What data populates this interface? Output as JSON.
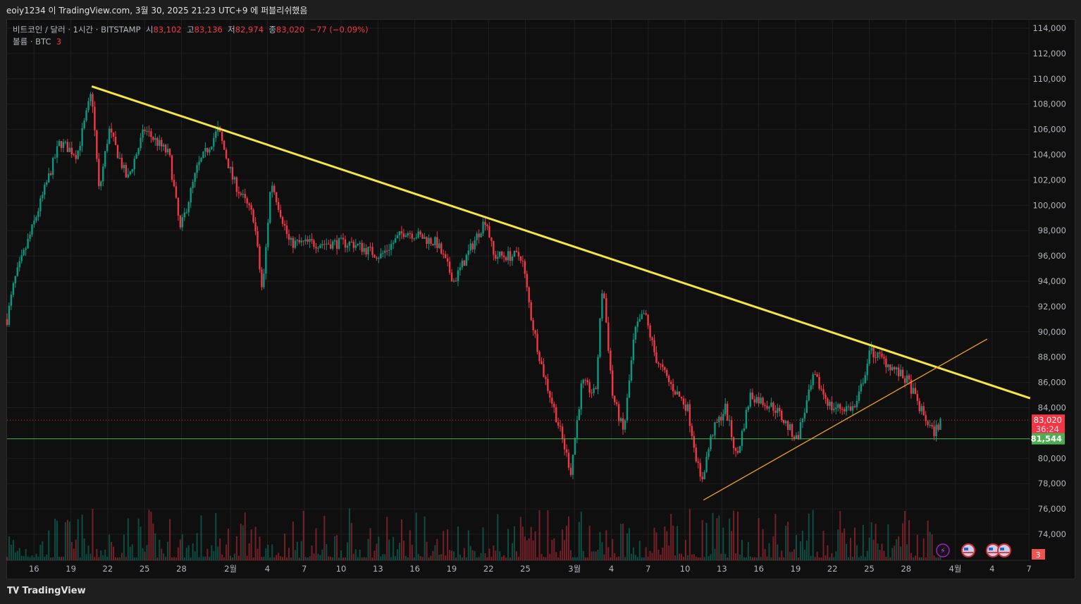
{
  "header": {
    "published": "eoiy1234 이 TradingView.com, 3월 30, 2025 21:23 UTC+9 에 퍼블리쉬했음"
  },
  "legend": {
    "symbol": "비트코인 / 달러 · 1시간 · BITSTAMP",
    "open_label": "시",
    "open": "83,102",
    "high_label": "고",
    "high": "83,136",
    "low_label": "저",
    "low": "82,974",
    "close_label": "종",
    "close": "83,020",
    "change": "−77 (−0.09%)",
    "volume_label": "볼륨 · BTC",
    "volume": "3"
  },
  "price_axis": [
    "114,000",
    "112,000",
    "110,000",
    "108,000",
    "106,000",
    "104,000",
    "102,000",
    "100,000",
    "98,000",
    "96,000",
    "94,000",
    "92,000",
    "90,000",
    "88,000",
    "86,000",
    "84,000",
    "80,000",
    "78,000",
    "76,000",
    "74,000"
  ],
  "time_axis": [
    {
      "label": "16",
      "day": 3
    },
    {
      "label": "19",
      "day": 6
    },
    {
      "label": "22",
      "day": 9
    },
    {
      "label": "25",
      "day": 12
    },
    {
      "label": "28",
      "day": 15
    },
    {
      "label": "2월",
      "day": 19
    },
    {
      "label": "4",
      "day": 22
    },
    {
      "label": "7",
      "day": 25
    },
    {
      "label": "10",
      "day": 28
    },
    {
      "label": "13",
      "day": 31
    },
    {
      "label": "16",
      "day": 34
    },
    {
      "label": "19",
      "day": 37
    },
    {
      "label": "22",
      "day": 40
    },
    {
      "label": "25",
      "day": 43
    },
    {
      "label": "3월",
      "day": 47
    },
    {
      "label": "4",
      "day": 50
    },
    {
      "label": "7",
      "day": 53
    },
    {
      "label": "10",
      "day": 56
    },
    {
      "label": "13",
      "day": 59
    },
    {
      "label": "16",
      "day": 62
    },
    {
      "label": "19",
      "day": 65
    },
    {
      "label": "22",
      "day": 68
    },
    {
      "label": "25",
      "day": 71
    },
    {
      "label": "28",
      "day": 74
    },
    {
      "label": "4월",
      "day": 78
    },
    {
      "label": "4",
      "day": 81
    },
    {
      "label": "7",
      "day": 84
    }
  ],
  "price_tags": {
    "last": "83,020",
    "countdown": "36:24",
    "support": "81,544",
    "volume": "3"
  },
  "colors": {
    "up": "#089981",
    "down": "#f23645",
    "trend_main": "#f5e642",
    "trend_support": "#f0a020",
    "support": "#4caf50"
  },
  "brand": "TradingView",
  "chart_data": {
    "type": "candlestick",
    "x_unit": "days since Jan 13 2025",
    "ylim": [
      73000,
      115000
    ],
    "price_path": [
      [
        0.8,
        91000
      ],
      [
        1.4,
        94000
      ],
      [
        2.8,
        98000
      ],
      [
        5.1,
        105000
      ],
      [
        6.5,
        104000
      ],
      [
        7.7,
        109000
      ],
      [
        8.3,
        101000
      ],
      [
        9.1,
        106000
      ],
      [
        10.6,
        102000
      ],
      [
        12.0,
        106000
      ],
      [
        14.0,
        104000
      ],
      [
        14.9,
        98000
      ],
      [
        16.3,
        103000
      ],
      [
        18.0,
        106000
      ],
      [
        19.2,
        102000
      ],
      [
        20.9,
        99000
      ],
      [
        21.6,
        93000
      ],
      [
        22.3,
        102000
      ],
      [
        23.8,
        97000
      ],
      [
        26.0,
        97000
      ],
      [
        28.9,
        97000
      ],
      [
        31.2,
        96000
      ],
      [
        33.2,
        98000
      ],
      [
        35.8,
        97000
      ],
      [
        37.2,
        94000
      ],
      [
        39.8,
        99000
      ],
      [
        40.4,
        96000
      ],
      [
        42.7,
        96000
      ],
      [
        43.5,
        91000
      ],
      [
        44.4,
        87000
      ],
      [
        45.6,
        83000
      ],
      [
        46.7,
        79000
      ],
      [
        47.6,
        86000
      ],
      [
        48.7,
        85000
      ],
      [
        49.3,
        94000
      ],
      [
        50.1,
        85000
      ],
      [
        51.0,
        82000
      ],
      [
        51.9,
        90000
      ],
      [
        52.7,
        91500
      ],
      [
        53.6,
        88000
      ],
      [
        54.7,
        86000
      ],
      [
        56.2,
        84000
      ],
      [
        57.3,
        78000
      ],
      [
        58.2,
        82000
      ],
      [
        59.3,
        84000
      ],
      [
        60.2,
        80000
      ],
      [
        61.3,
        85000
      ],
      [
        63.3,
        84000
      ],
      [
        65.1,
        81500
      ],
      [
        66.5,
        86500
      ],
      [
        67.9,
        84000
      ],
      [
        69.9,
        84000
      ],
      [
        71.1,
        88500
      ],
      [
        72.5,
        87500
      ],
      [
        74.2,
        86000
      ],
      [
        75.1,
        84000
      ],
      [
        76.2,
        82000
      ],
      [
        76.9,
        83000
      ]
    ],
    "trendlines": [
      {
        "name": "descending resistance",
        "from": [
          7.7,
          109400
        ],
        "to": [
          84.1,
          84750
        ]
      },
      {
        "name": "ascending support",
        "from": [
          57.5,
          76700
        ],
        "to": [
          80.6,
          89430
        ]
      }
    ],
    "horizontal_lines": [
      {
        "name": "last price",
        "value": 83020
      },
      {
        "name": "support",
        "value": 81544
      }
    ]
  }
}
